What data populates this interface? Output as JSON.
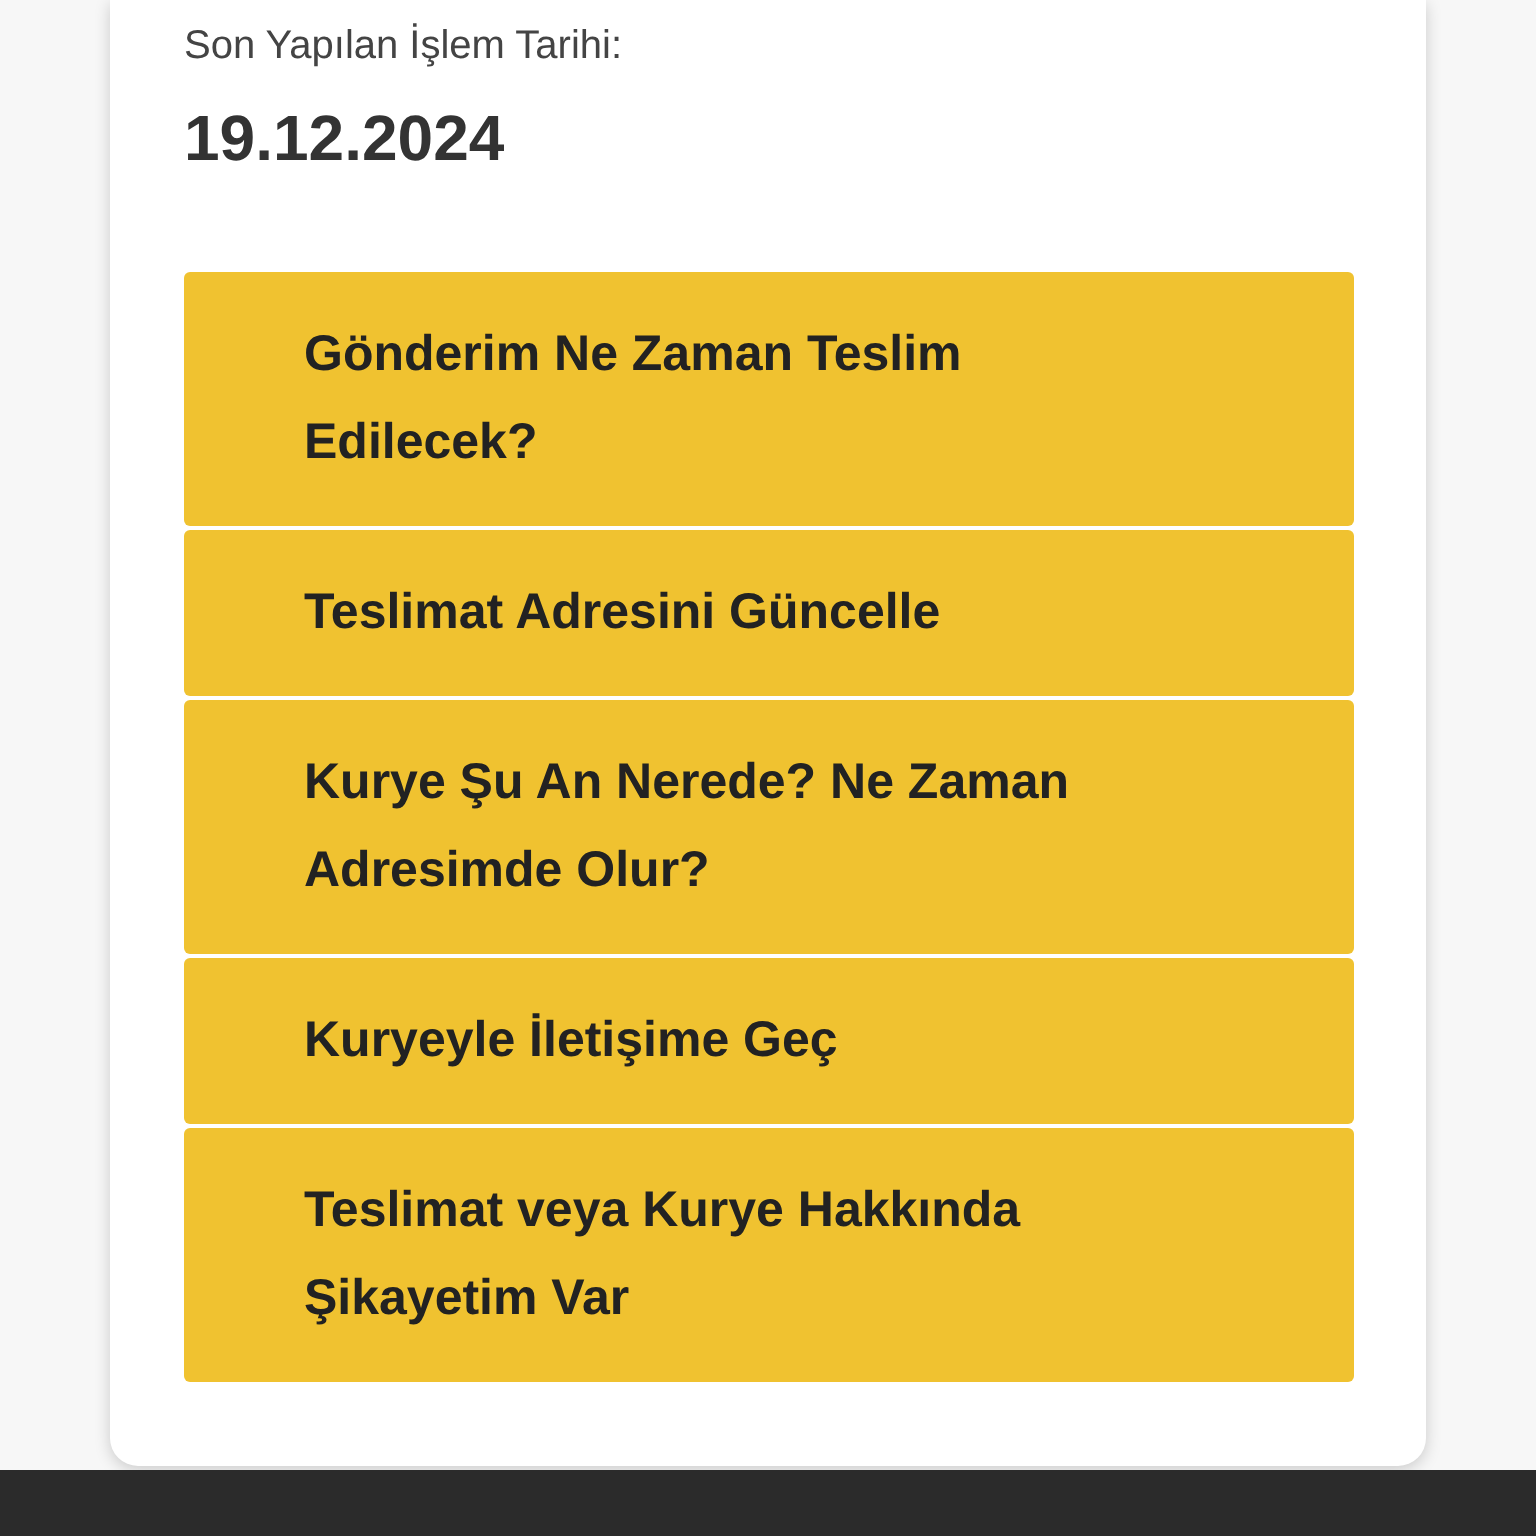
{
  "last_transaction": {
    "label": "Son Yapılan İşlem Tarihi:",
    "date": "19.12.2024"
  },
  "options": [
    "Gönderim Ne Zaman Teslim Edilecek?",
    "Teslimat Adresini Güncelle",
    "Kurye Şu An Nerede? Ne Zaman Adresimde Olur?",
    "Kuryeyle İletişime Geç",
    "Teslimat veya Kurye Hakkında Şikayetim Var"
  ]
}
